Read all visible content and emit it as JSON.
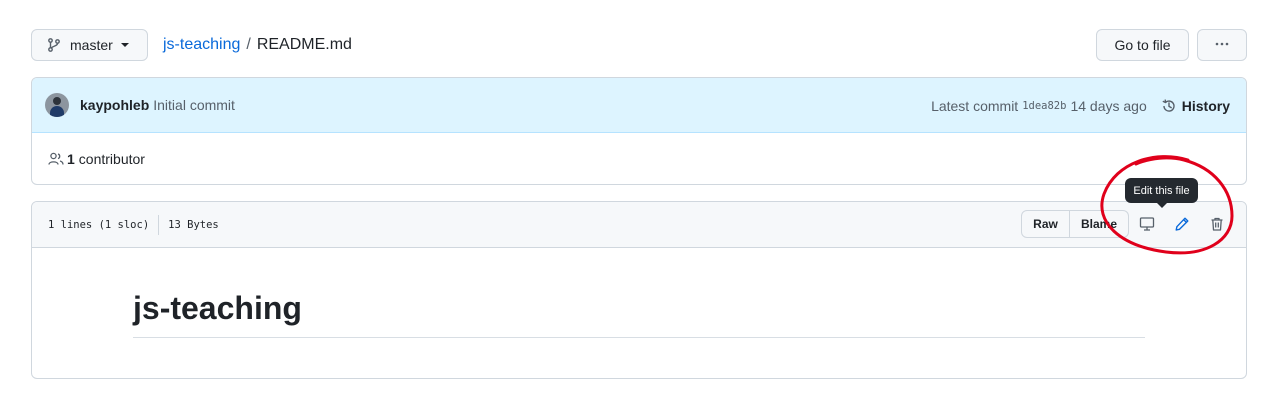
{
  "toolbar": {
    "branch": "master",
    "breadcrumb_repo": "js-teaching",
    "breadcrumb_separator": "/",
    "breadcrumb_file": "README.md",
    "goto_file_label": "Go to file",
    "more_icon": "kebab-horizontal-icon"
  },
  "commit": {
    "author": "kaypohleb",
    "message": "Initial commit",
    "latest_label": "Latest commit",
    "sha": "1dea82b",
    "age": "14 days ago",
    "history_label": "History"
  },
  "contributors": {
    "count": "1",
    "label": "contributor"
  },
  "file": {
    "lines_info": "1 lines (1 sloc)",
    "size": "13 Bytes",
    "raw_label": "Raw",
    "blame_label": "Blame",
    "tooltip": "Edit this file"
  },
  "content": {
    "heading": "js-teaching"
  },
  "colors": {
    "accent": "#0969da",
    "commit_bar": "#ddf4ff",
    "annotation": "#e0001b"
  }
}
